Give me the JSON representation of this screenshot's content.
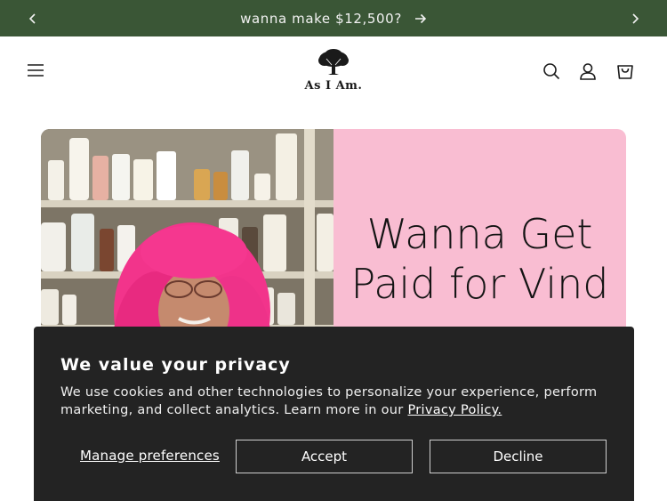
{
  "announcement": {
    "text": "wanna make $12,500?",
    "bg_color": "#3a5636"
  },
  "header": {
    "logo_text": "As I Am."
  },
  "hero": {
    "title": "Wanna Get Paid for Vind",
    "panel_color": "#f9bdd2"
  },
  "cookie_banner": {
    "title": "We value your privacy",
    "body": "We use cookies and other technologies to personalize your experience, perform marketing, and collect analytics. Learn more in our ",
    "policy_link": "Privacy Policy.",
    "manage_label": "Manage preferences",
    "accept_label": "Accept",
    "decline_label": "Decline"
  },
  "icons": [
    "chevron-left-icon",
    "chevron-right-icon",
    "arrow-right-icon",
    "menu-icon",
    "search-icon",
    "account-icon",
    "cart-icon"
  ]
}
